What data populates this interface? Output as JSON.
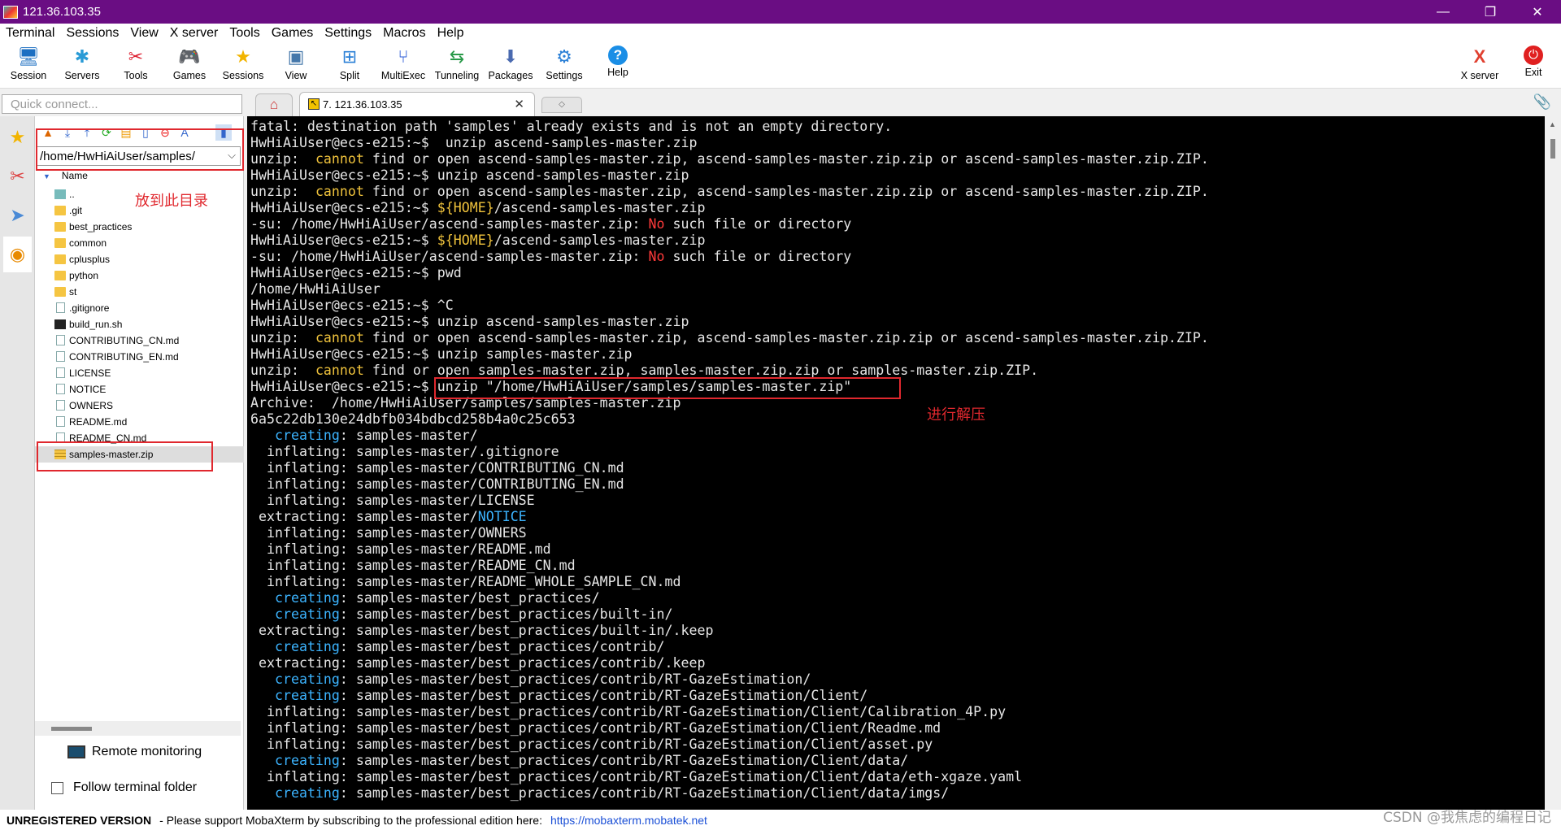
{
  "window": {
    "title": "121.36.103.35",
    "minimize": "—",
    "maximize": "❐",
    "close": "✕"
  },
  "menu": [
    "Terminal",
    "Sessions",
    "View",
    "X server",
    "Tools",
    "Games",
    "Settings",
    "Macros",
    "Help"
  ],
  "toolbar": {
    "session": "Session",
    "servers": "Servers",
    "tools": "Tools",
    "games": "Games",
    "sessions": "Sessions",
    "view": "View",
    "split": "Split",
    "multiexec": "MultiExec",
    "tunneling": "Tunneling",
    "packages": "Packages",
    "settings": "Settings",
    "help": "Help",
    "xserver": "X server",
    "exit": "Exit"
  },
  "quick_connect": {
    "placeholder": "Quick connect..."
  },
  "tabs": {
    "active_label": "7. 121.36.103.35",
    "close": "✕"
  },
  "sidebar": {
    "path": "/home/HwHiAiUser/samples/",
    "header": "Name",
    "files": [
      {
        "name": "..",
        "type": "up"
      },
      {
        "name": ".git",
        "type": "folder"
      },
      {
        "name": "best_practices",
        "type": "folder"
      },
      {
        "name": "common",
        "type": "folder"
      },
      {
        "name": "cplusplus",
        "type": "folder"
      },
      {
        "name": "python",
        "type": "folder"
      },
      {
        "name": "st",
        "type": "folder"
      },
      {
        "name": ".gitignore",
        "type": "file"
      },
      {
        "name": "build_run.sh",
        "type": "shell"
      },
      {
        "name": "CONTRIBUTING_CN.md",
        "type": "file"
      },
      {
        "name": "CONTRIBUTING_EN.md",
        "type": "file"
      },
      {
        "name": "LICENSE",
        "type": "file"
      },
      {
        "name": "NOTICE",
        "type": "file"
      },
      {
        "name": "OWNERS",
        "type": "file"
      },
      {
        "name": "README.md",
        "type": "file"
      },
      {
        "name": "README_CN.md",
        "type": "file"
      },
      {
        "name": "samples-master.zip",
        "type": "zip"
      }
    ],
    "remote_monitoring": "Remote monitoring",
    "follow_terminal": "Follow terminal folder"
  },
  "annotations": {
    "dir_note": "放到此目录",
    "unzip_note": "进行解压"
  },
  "terminal": {
    "lines": [
      [
        {
          "t": "fatal: destination path 'samples' already exists and is not an empty directory."
        }
      ],
      [
        {
          "t": "HwHiAiUser@ecs-e215:~$  unzip ascend-samples-master.zip"
        }
      ],
      [
        {
          "t": "unzip:  "
        },
        {
          "t": "cannot",
          "c": "y"
        },
        {
          "t": " find or open ascend-samples-master.zip, ascend-samples-master.zip.zip or ascend-samples-master.zip.ZIP."
        }
      ],
      [
        {
          "t": "HwHiAiUser@ecs-e215:~$ unzip ascend-samples-master.zip"
        }
      ],
      [
        {
          "t": "unzip:  "
        },
        {
          "t": "cannot",
          "c": "y"
        },
        {
          "t": " find or open ascend-samples-master.zip, ascend-samples-master.zip.zip or ascend-samples-master.zip.ZIP."
        }
      ],
      [
        {
          "t": "HwHiAiUser@ecs-e215:~$ "
        },
        {
          "t": "${HOME}",
          "c": "y"
        },
        {
          "t": "/ascend-samples-master.zip"
        }
      ],
      [
        {
          "t": "-su: /home/HwHiAiUser/ascend-samples-master.zip: "
        },
        {
          "t": "No",
          "c": "r"
        },
        {
          "t": " such file or directory"
        }
      ],
      [
        {
          "t": "HwHiAiUser@ecs-e215:~$ "
        },
        {
          "t": "${HOME}",
          "c": "y"
        },
        {
          "t": "/ascend-samples-master.zip"
        }
      ],
      [
        {
          "t": "-su: /home/HwHiAiUser/ascend-samples-master.zip: "
        },
        {
          "t": "No",
          "c": "r"
        },
        {
          "t": " such file or directory"
        }
      ],
      [
        {
          "t": "HwHiAiUser@ecs-e215:~$ pwd"
        }
      ],
      [
        {
          "t": "/home/HwHiAiUser"
        }
      ],
      [
        {
          "t": "HwHiAiUser@ecs-e215:~$ ^C"
        }
      ],
      [
        {
          "t": "HwHiAiUser@ecs-e215:~$ unzip ascend-samples-master.zip"
        }
      ],
      [
        {
          "t": "unzip:  "
        },
        {
          "t": "cannot",
          "c": "y"
        },
        {
          "t": " find or open ascend-samples-master.zip, ascend-samples-master.zip.zip or ascend-samples-master.zip.ZIP."
        }
      ],
      [
        {
          "t": "HwHiAiUser@ecs-e215:~$ unzip samples-master.zip"
        }
      ],
      [
        {
          "t": "unzip:  "
        },
        {
          "t": "cannot",
          "c": "y"
        },
        {
          "t": " find or open samples-master.zip, samples-master.zip.zip or samples-master.zip.ZIP."
        }
      ],
      [
        {
          "t": "HwHiAiUser@ecs-e215:~$ unzip \"/home/HwHiAiUser/samples/samples-master.zip\""
        }
      ],
      [
        {
          "t": "Archive:  /home/HwHiAiUser/samples/samples-master.zip"
        }
      ],
      [
        {
          "t": "6a5c22db130e24dbfb034bdbcd258b4a0c25c653"
        }
      ],
      [
        {
          "t": "   "
        },
        {
          "t": "creating",
          "c": "c"
        },
        {
          "t": ": samples-master/"
        }
      ],
      [
        {
          "t": "  inflating: samples-master/.gitignore"
        }
      ],
      [
        {
          "t": "  inflating: samples-master/CONTRIBUTING_CN.md"
        }
      ],
      [
        {
          "t": "  inflating: samples-master/CONTRIBUTING_EN.md"
        }
      ],
      [
        {
          "t": "  inflating: samples-master/LICENSE"
        }
      ],
      [
        {
          "t": " extracting: samples-master/"
        },
        {
          "t": "NOTICE",
          "c": "c"
        }
      ],
      [
        {
          "t": "  inflating: samples-master/OWNERS"
        }
      ],
      [
        {
          "t": "  inflating: samples-master/README.md"
        }
      ],
      [
        {
          "t": "  inflating: samples-master/README_CN.md"
        }
      ],
      [
        {
          "t": "  inflating: samples-master/README_WHOLE_SAMPLE_CN.md"
        }
      ],
      [
        {
          "t": "   "
        },
        {
          "t": "creating",
          "c": "c"
        },
        {
          "t": ": samples-master/best_practices/"
        }
      ],
      [
        {
          "t": "   "
        },
        {
          "t": "creating",
          "c": "c"
        },
        {
          "t": ": samples-master/best_practices/built-in/"
        }
      ],
      [
        {
          "t": " extracting: samples-master/best_practices/built-in/.keep"
        }
      ],
      [
        {
          "t": "   "
        },
        {
          "t": "creating",
          "c": "c"
        },
        {
          "t": ": samples-master/best_practices/contrib/"
        }
      ],
      [
        {
          "t": " extracting: samples-master/best_practices/contrib/.keep"
        }
      ],
      [
        {
          "t": "   "
        },
        {
          "t": "creating",
          "c": "c"
        },
        {
          "t": ": samples-master/best_practices/contrib/RT-GazeEstimation/"
        }
      ],
      [
        {
          "t": "   "
        },
        {
          "t": "creating",
          "c": "c"
        },
        {
          "t": ": samples-master/best_practices/contrib/RT-GazeEstimation/Client/"
        }
      ],
      [
        {
          "t": "  inflating: samples-master/best_practices/contrib/RT-GazeEstimation/Client/Calibration_4P.py"
        }
      ],
      [
        {
          "t": "  inflating: samples-master/best_practices/contrib/RT-GazeEstimation/Client/Readme.md"
        }
      ],
      [
        {
          "t": "  inflating: samples-master/best_practices/contrib/RT-GazeEstimation/Client/asset.py"
        }
      ],
      [
        {
          "t": "   "
        },
        {
          "t": "creating",
          "c": "c"
        },
        {
          "t": ": samples-master/best_practices/contrib/RT-GazeEstimation/Client/data/"
        }
      ],
      [
        {
          "t": "  inflating: samples-master/best_practices/contrib/RT-GazeEstimation/Client/data/eth-xgaze.yaml"
        }
      ],
      [
        {
          "t": "   "
        },
        {
          "t": "creating",
          "c": "c"
        },
        {
          "t": ": samples-master/best_practices/contrib/RT-GazeEstimation/Client/data/imgs/"
        }
      ]
    ]
  },
  "statusbar": {
    "unregistered": "UNREGISTERED VERSION",
    "message": "-  Please support MobaXterm by subscribing to the professional edition here:",
    "link": "https://mobaxterm.mobatek.net"
  },
  "watermark": "CSDN @我焦虑的编程日记"
}
